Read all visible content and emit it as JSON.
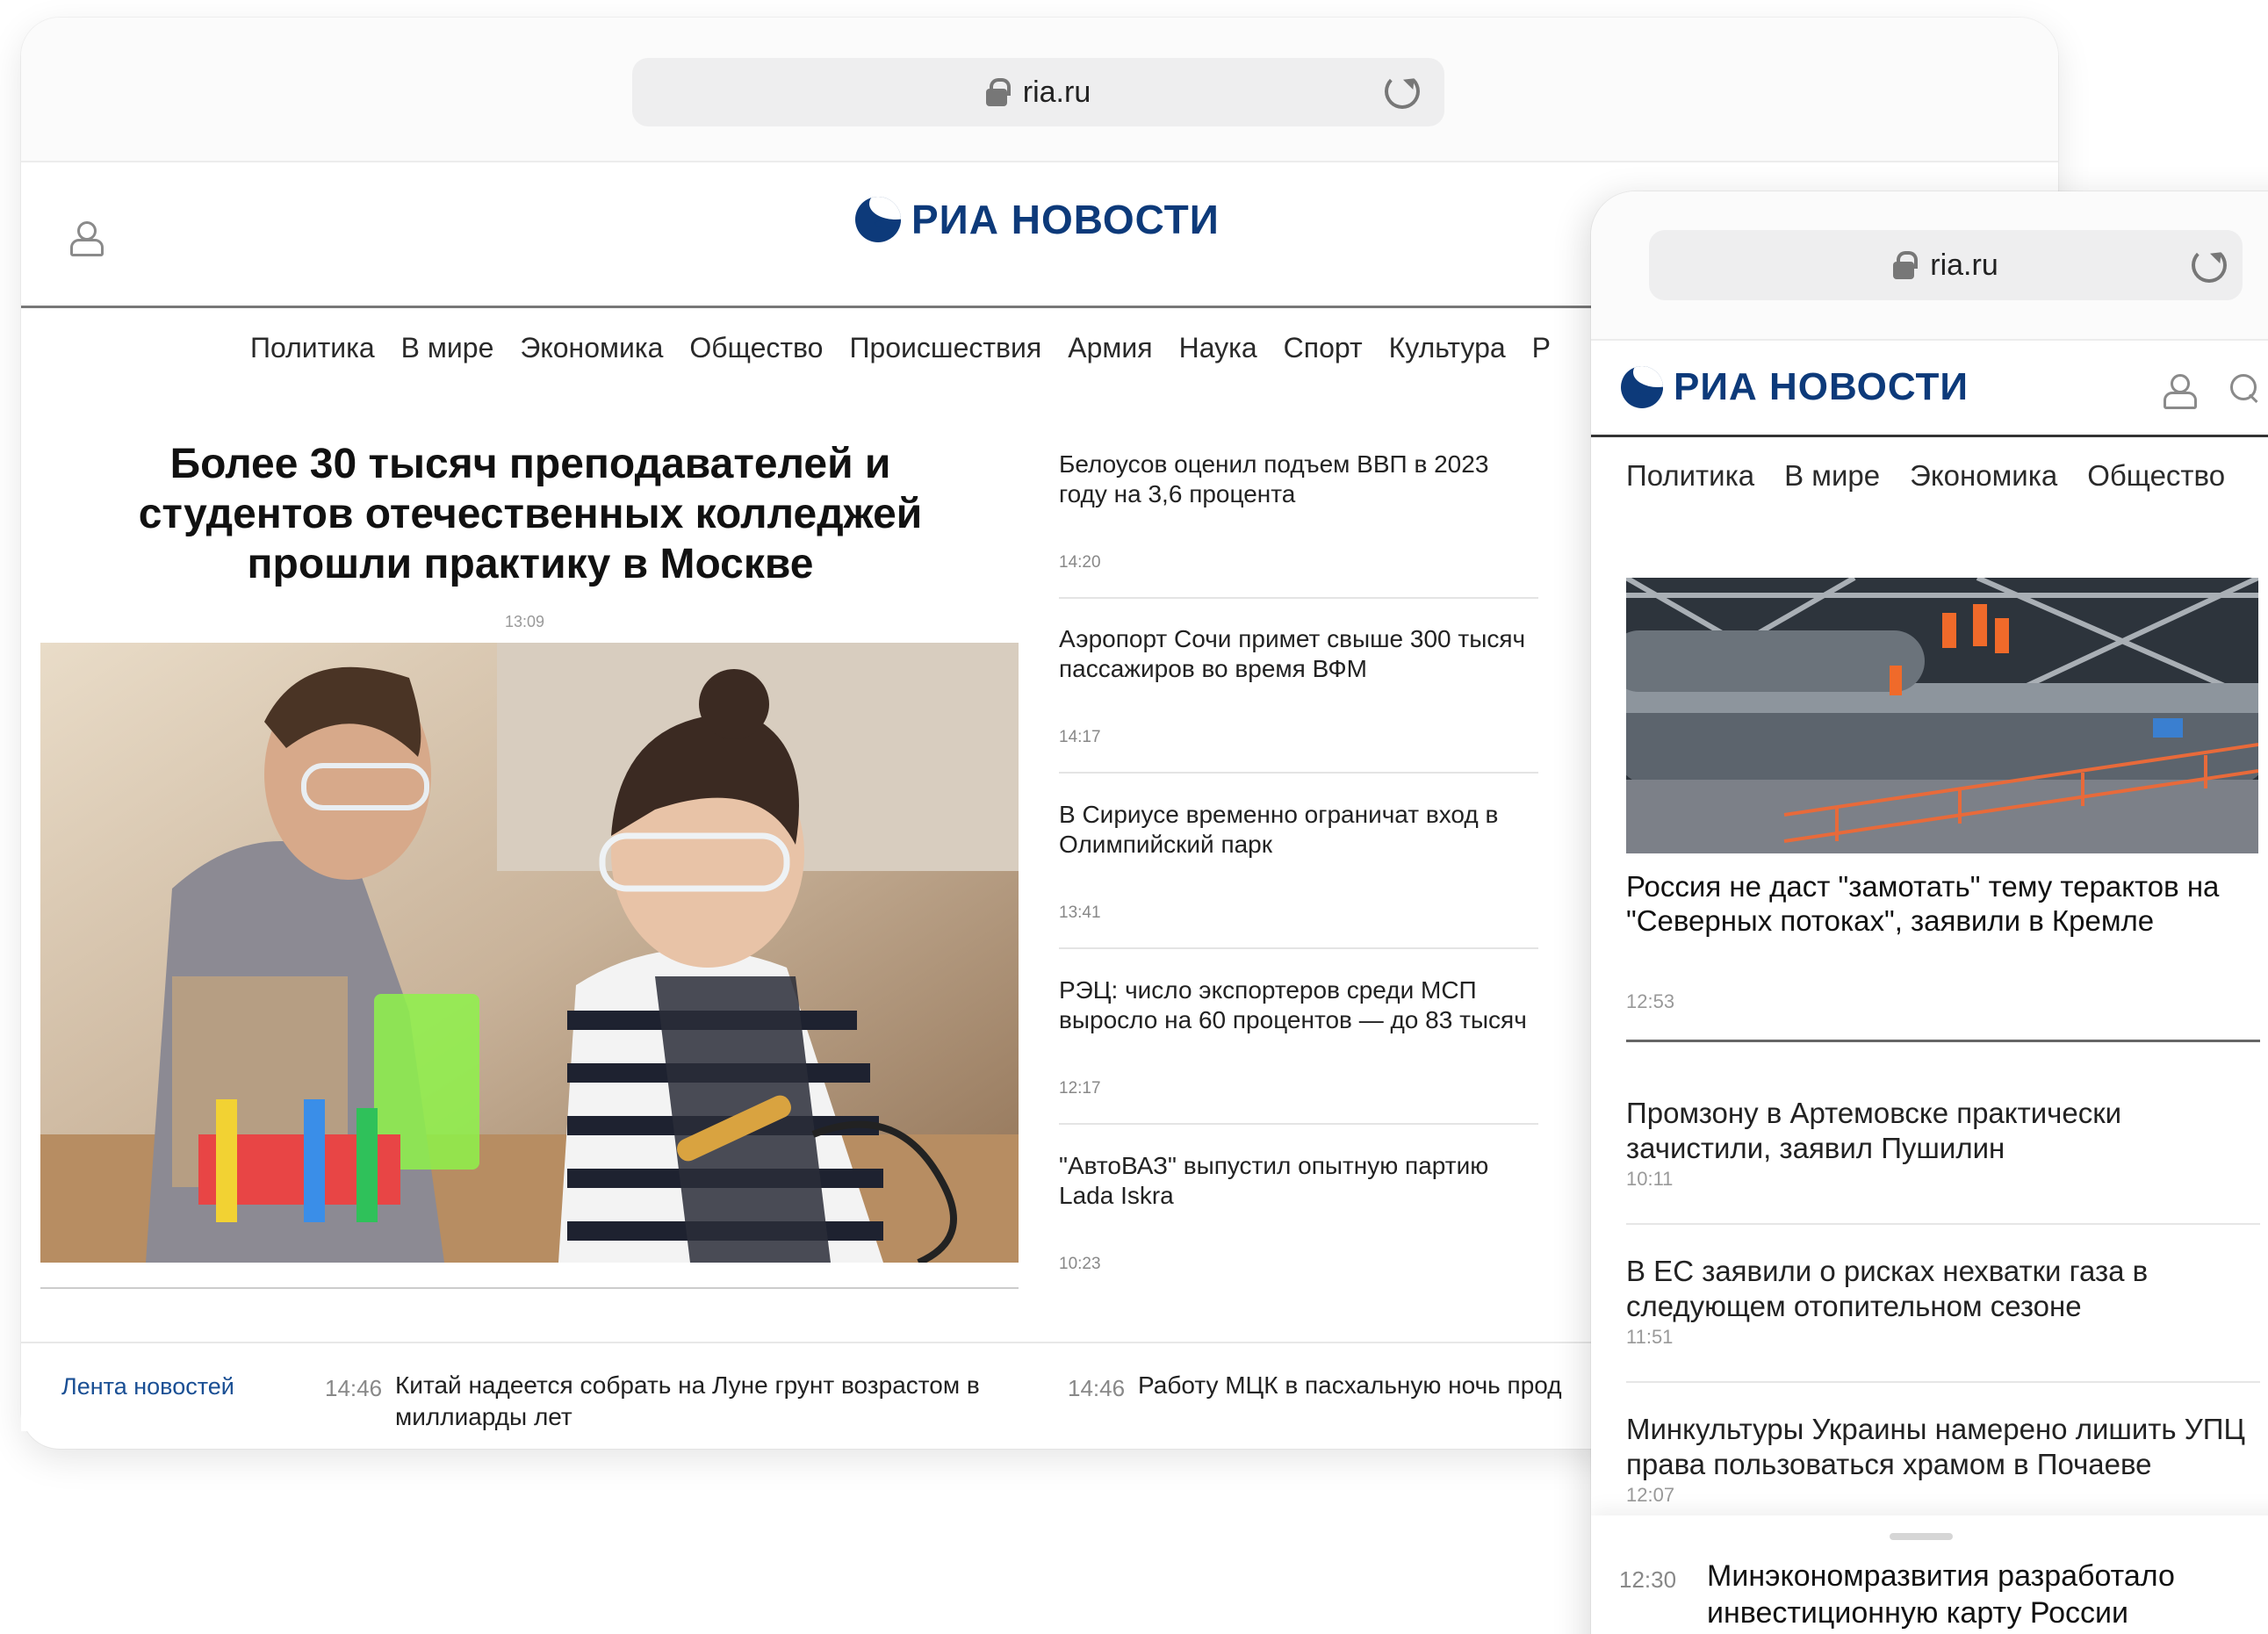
{
  "desktop": {
    "url": "ria.ru",
    "logo_text": "РИА НОВОСТИ",
    "nav": [
      "Политика",
      "В мире",
      "Экономика",
      "Общество",
      "Происшествия",
      "Армия",
      "Наука",
      "Спорт",
      "Культура",
      "Р"
    ],
    "main": {
      "title": "Более 30 тысяч преподавателей и студентов отечественных колледжей прошли практику в Москве",
      "time": "13:09"
    },
    "side_news": [
      {
        "title": "Белоусов оценил подъем ВВП в 2023 году на 3,6 процента",
        "time": "14:20"
      },
      {
        "title": "Аэропорт Сочи примет свыше 300 тысяч пассажиров во время ВФМ",
        "time": "14:17"
      },
      {
        "title": "В Сириусе временно ограничат вход в Олимпийский парк",
        "time": "13:41"
      },
      {
        "title": "РЭЦ: число экспортеров среди МСП выросло на 60 процентов — до 83 тысяч",
        "time": "12:17"
      },
      {
        "title": "\"АвтоВАЗ\" выпустил опытную партию Lada Iskra",
        "time": "10:23"
      }
    ],
    "feed": {
      "label": "Лента новостей",
      "items": [
        {
          "time": "14:46",
          "text": "Китай надеется собрать на Луне грунт возрастом в миллиарды лет"
        },
        {
          "time": "14:46",
          "text": "Работу МЦК в пасхальную ночь прод"
        }
      ]
    }
  },
  "mobile": {
    "url": "ria.ru",
    "logo_text": "РИА НОВОСТИ",
    "nav": [
      "Политика",
      "В мире",
      "Экономика",
      "Общество"
    ],
    "lead": {
      "title": "Россия не даст \"замотать\" тему терактов на \"Северных потоках\", заявили в Кремле",
      "time": "12:53"
    },
    "news": [
      {
        "title": "Промзону в Артемовске практически зачистили, заявил Пушилин",
        "time": "10:11"
      },
      {
        "title": "В ЕС заявили о рисках нехватки газа в следующем отопительном сезоне",
        "time": "11:51"
      },
      {
        "title": "Минкультуры Украины намерено лишить УПЦ права пользоваться храмом в Почаеве",
        "time": "12:07"
      }
    ],
    "bottom": {
      "time": "12:30",
      "text": "Минэкономразвития разработало инвестиционную карту России"
    }
  }
}
